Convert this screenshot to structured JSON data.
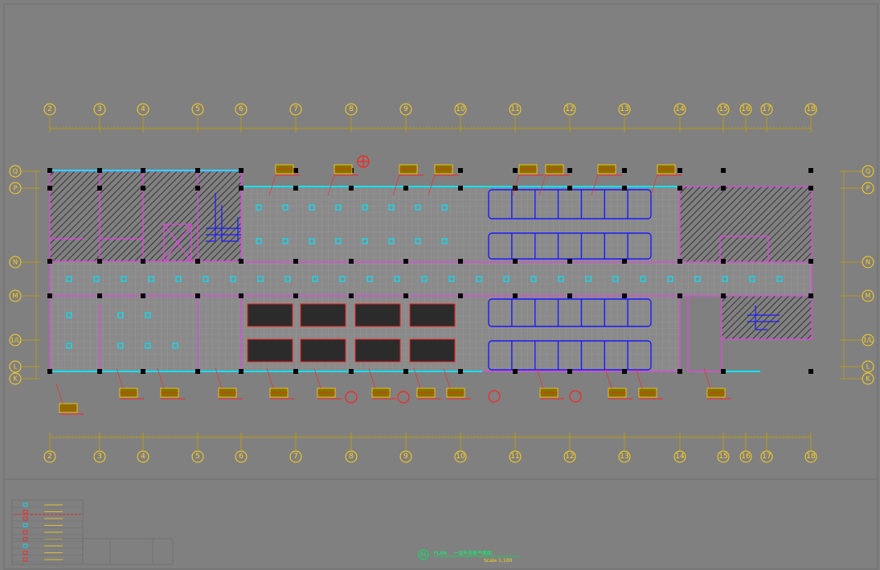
{
  "drawing": {
    "title_prefix": "PLAN",
    "title_main": "一层天花板平面图",
    "scale_text": "Scale 1:100",
    "title_badge": "01"
  },
  "grid": {
    "columns": [
      "2",
      "3",
      "4",
      "5",
      "6",
      "7",
      "8",
      "9",
      "10",
      "11",
      "12",
      "13",
      "14",
      "15",
      "16",
      "17",
      "18"
    ],
    "rows": [
      "Q",
      "P",
      "N",
      "M",
      "1/L",
      "L",
      "K"
    ]
  },
  "colors": {
    "background": "#808080",
    "grid_line": "#c8a000",
    "wall": "#ff33ff",
    "cyan": "#00e5ff",
    "red": "#ff2020",
    "blue": "#1010ff",
    "yellow": "#ffd11a",
    "hatch": "#222222"
  },
  "icons": [
    "section-marker-icon",
    "grid-bubble-icon",
    "light-fixture-icon",
    "stair-icon",
    "legend-symbol-icon"
  ]
}
